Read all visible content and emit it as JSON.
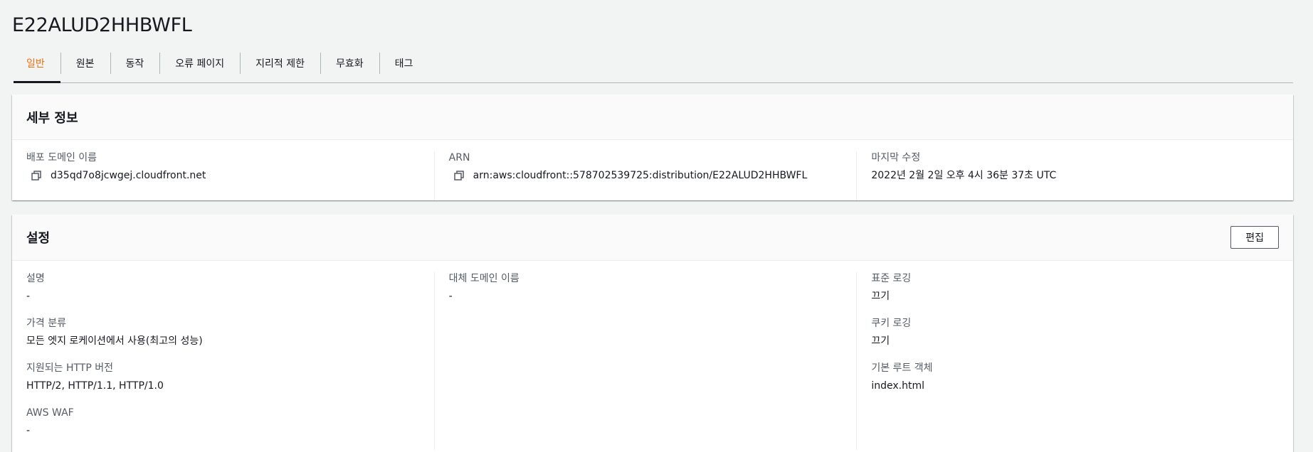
{
  "page": {
    "title": "E22ALUD2HHBWFL"
  },
  "tabs": [
    {
      "label": "일반",
      "active": true
    },
    {
      "label": "원본"
    },
    {
      "label": "동작"
    },
    {
      "label": "오류 페이지"
    },
    {
      "label": "지리적 제한"
    },
    {
      "label": "무효화"
    },
    {
      "label": "태그"
    }
  ],
  "details": {
    "title": "세부 정보",
    "domain_key": "배포 도메인 이름",
    "domain_value": "d35qd7o8jcwgej.cloudfront.net",
    "arn_key": "ARN",
    "arn_value": "arn:aws:cloudfront::578702539725:distribution/E22ALUD2HHBWFL",
    "modified_key": "마지막 수정",
    "modified_value": "2022년 2월 2일 오후 4시 36분 37초 UTC"
  },
  "settings": {
    "title": "설정",
    "edit_label": "편집",
    "description_key": "설명",
    "description_value": "-",
    "price_class_key": "가격 분류",
    "price_class_value": "모든 엣지 로케이션에서 사용(최고의 성능)",
    "http_key": "지원되는 HTTP 버전",
    "http_value": "HTTP/2, HTTP/1.1, HTTP/1.0",
    "waf_key": "AWS WAF",
    "waf_value": "-",
    "alt_domain_key": "대체 도메인 이름",
    "alt_domain_value": "-",
    "std_logging_key": "표준 로깅",
    "std_logging_value": "끄기",
    "cookie_logging_key": "쿠키 로깅",
    "cookie_logging_value": "끄기",
    "root_object_key": "기본 루트 객체",
    "root_object_value": "index.html"
  },
  "icons": {
    "copy": "copy-icon"
  },
  "colors": {
    "active_tab": "#ec7211",
    "background": "#f2f3f3"
  }
}
